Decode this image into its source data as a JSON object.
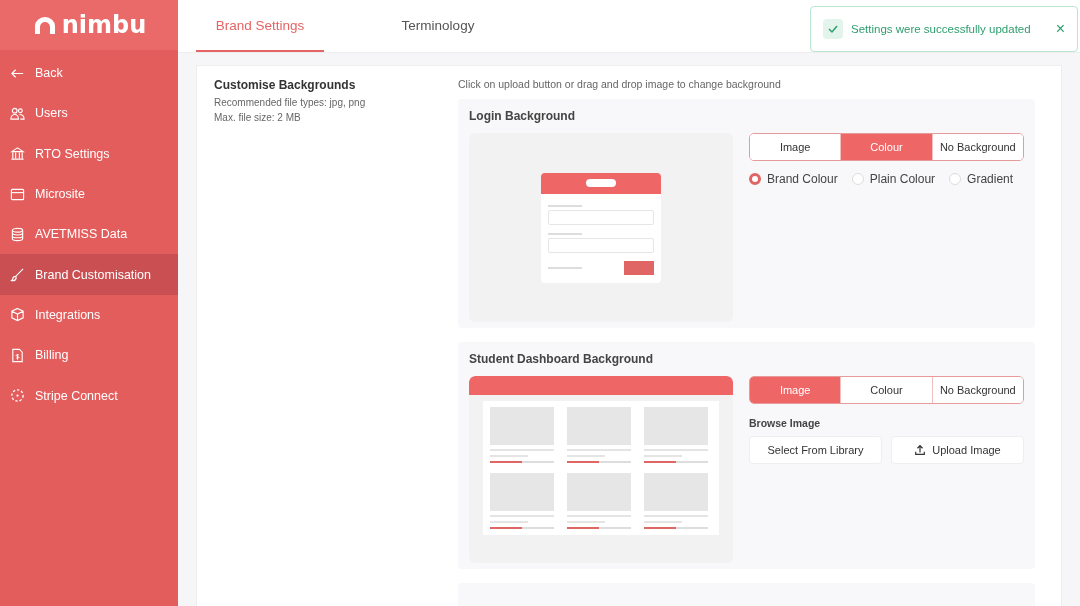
{
  "logo": {
    "name": "nimbu"
  },
  "sidebar": {
    "items": [
      {
        "label": "Back",
        "selected": false
      },
      {
        "label": "Users",
        "selected": false
      },
      {
        "label": "RTO Settings",
        "selected": false
      },
      {
        "label": "Microsite",
        "selected": false
      },
      {
        "label": "AVETMISS Data",
        "selected": false
      },
      {
        "label": "Brand Customisation",
        "selected": true
      },
      {
        "label": "Integrations",
        "selected": false
      },
      {
        "label": "Billing",
        "selected": false
      },
      {
        "label": "Stripe Connect",
        "selected": false
      }
    ]
  },
  "tabs": [
    {
      "label": "Brand Settings",
      "selected": true
    },
    {
      "label": "Terminology",
      "selected": false
    }
  ],
  "toast": {
    "message": "Settings were successfully updated",
    "close": "×"
  },
  "panel": {
    "title": "Customise Backgrounds",
    "hints": [
      "Recommended file types: jpg, png",
      "Max. file size: 2 MB"
    ],
    "instruction": "Click on upload button or drag and drop image to change background",
    "sections": [
      {
        "title": "Login Background",
        "options": [
          {
            "label": "Image",
            "selected": false
          },
          {
            "label": "Colour",
            "selected": true
          },
          {
            "label": "No Background",
            "selected": false
          }
        ],
        "kind": "radios",
        "radios": [
          {
            "label": "Brand Colour",
            "selected": true
          },
          {
            "label": "Plain Colour",
            "selected": false
          },
          {
            "label": "Gradient",
            "selected": false
          }
        ]
      },
      {
        "title": "Student Dashboard Background",
        "options": [
          {
            "label": "Image",
            "selected": true
          },
          {
            "label": "Colour",
            "selected": false
          },
          {
            "label": "No Background",
            "selected": false
          }
        ],
        "kind": "browse",
        "browse_label": "Browse Image",
        "buttons": [
          {
            "label": "Select From Library",
            "kind": "plain"
          },
          {
            "label": "Upload Image",
            "kind": "upload"
          }
        ]
      }
    ]
  }
}
